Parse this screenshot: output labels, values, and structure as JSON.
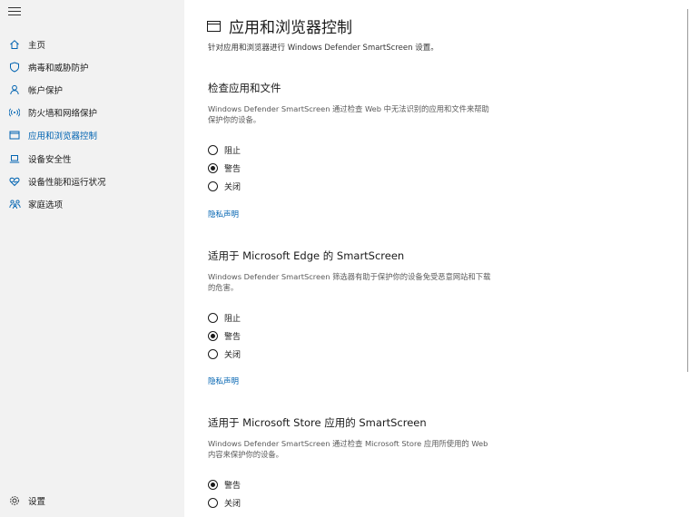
{
  "sidebar": {
    "items": [
      {
        "label": "主页",
        "icon": "home-icon"
      },
      {
        "label": "病毒和威胁防护",
        "icon": "shield-icon"
      },
      {
        "label": "帐户保护",
        "icon": "person-icon"
      },
      {
        "label": "防火墙和网络保护",
        "icon": "wifi-icon"
      },
      {
        "label": "应用和浏览器控制",
        "icon": "app-window-icon",
        "active": true
      },
      {
        "label": "设备安全性",
        "icon": "laptop-icon"
      },
      {
        "label": "设备性能和运行状况",
        "icon": "heart-icon"
      },
      {
        "label": "家庭选项",
        "icon": "family-icon"
      }
    ],
    "settings_label": "设置"
  },
  "main": {
    "title": "应用和浏览器控制",
    "subtitle": "针对应用和浏览器进行 Windows Defender SmartScreen 设置。",
    "sections": [
      {
        "title": "检查应用和文件",
        "description": "Windows Defender SmartScreen 通过检查 Web 中无法识别的应用和文件来帮助保护你的设备。",
        "options": [
          "阻止",
          "警告",
          "关闭"
        ],
        "selected": "警告",
        "link": "隐私声明"
      },
      {
        "title": "适用于 Microsoft Edge 的 SmartScreen",
        "description": "Windows Defender SmartScreen 筛选器有助于保护你的设备免受恶意网站和下载的危害。",
        "options": [
          "阻止",
          "警告",
          "关闭"
        ],
        "selected": "警告",
        "link": "隐私声明"
      },
      {
        "title": "适用于 Microsoft Store 应用的 SmartScreen",
        "description": "Windows Defender SmartScreen 通过检查 Microsoft Store 应用所使用的 Web 内容来保护你的设备。",
        "options": [
          "警告",
          "关闭"
        ],
        "selected": "警告"
      }
    ]
  },
  "colors": {
    "accent": "#0063b1",
    "sidebar_bg": "#f2f2f2"
  }
}
